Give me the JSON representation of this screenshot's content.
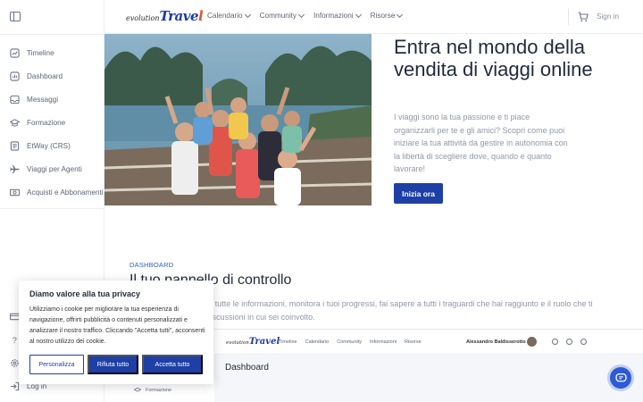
{
  "sidebar": {
    "items": [
      {
        "label": "Timeline",
        "icon": "timeline-icon"
      },
      {
        "label": "Dashboard",
        "icon": "dashboard-icon"
      },
      {
        "label": "Messaggi",
        "icon": "messages-icon"
      },
      {
        "label": "Formazione",
        "icon": "graduation-cap-icon"
      },
      {
        "label": "EtWay (CRS)",
        "icon": "document-icon"
      },
      {
        "label": "Viaggi per Agenti",
        "icon": "plane-icon"
      },
      {
        "label": "Acquisti e Abbonamenti",
        "icon": "money-icon"
      }
    ],
    "bottom_items": [
      {
        "label": "",
        "icon": "card-icon"
      },
      {
        "label": "",
        "icon": "help-icon"
      },
      {
        "label": "",
        "icon": "settings-icon"
      },
      {
        "label": "Log in",
        "icon": "login-icon"
      }
    ]
  },
  "header": {
    "logo_small": "evolution",
    "logo_big_a": "Trave",
    "logo_big_b": "l",
    "menu": [
      "Calendario",
      "Community",
      "Informazioni",
      "Risorse"
    ],
    "signin": "Sign in"
  },
  "hero": {
    "title": "Entra nel mondo della vendita di viaggi online",
    "text": "I viaggi sono la tua passione e ti piace organizzarli per te e gli amici? Scopri come puoi iniziare la tua attività da gestire in autonomia con la libertà di scegliere dove, quando e quanto lavorare!",
    "button": "Inizia ora"
  },
  "section": {
    "eyebrow": "DASHBOARD",
    "title": "Il tuo pannello di controllo",
    "text": "Trova in un unico posto tutte le informazioni, monitora i tuoi progressi, fai sapere a tutti i traguardi che hai raggiunto e il ruolo che ti spetta, partecipa alle discussioni in cui sei coinvolto."
  },
  "preview": {
    "logo_small": "evolution",
    "logo_big": "Travel",
    "nav": [
      "Timeline",
      "Calendario",
      "Community",
      "Informazioni",
      "Risorse"
    ],
    "user": "Alessandro Baldisserotto",
    "page_title": "Dashboard",
    "sidebar_item": "Formazione"
  },
  "cookie": {
    "title": "Diamo valore alla tua privacy",
    "text": "Utilizziamo i cookie per migliorare la tua esperienza di navigazione, offrirti pubblicità o contenuti personalizzati e analizzare il nostro traffico. Cliccando \"Accetta tutti\", acconsenti al nostro utilizzo dei cookie.",
    "btn_customize": "Personalizza",
    "btn_reject": "Rifiuta tutto",
    "btn_accept": "Accetta tutto"
  },
  "colors": {
    "brand_blue": "#1e3fa6",
    "brand_orange": "#e2542a",
    "chat_blue": "#2d5bd4"
  }
}
